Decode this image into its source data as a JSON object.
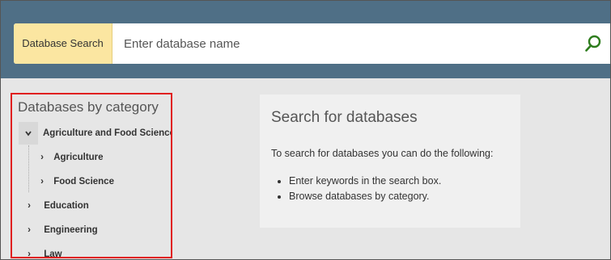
{
  "search": {
    "label": "Database Search",
    "placeholder": "Enter database name",
    "icon": "search-icon"
  },
  "categories": {
    "title": "Databases by category",
    "expanded": {
      "label": "Agriculture and Food Sciences",
      "children": [
        {
          "label": "Agriculture"
        },
        {
          "label": "Food Science"
        }
      ]
    },
    "items": [
      {
        "label": "Education"
      },
      {
        "label": "Engineering"
      },
      {
        "label": "Law"
      }
    ]
  },
  "info": {
    "title": "Search for databases",
    "intro": "To search for databases you can do the following:",
    "bullets": [
      "Enter keywords in the search box.",
      "Browse databases by category."
    ]
  },
  "colors": {
    "header": "#4f6f86",
    "search_label_bg": "#fbe6a1",
    "search_icon": "#2e7d1e",
    "highlight_border": "#e02020",
    "page_bg": "#e6e6e6"
  }
}
